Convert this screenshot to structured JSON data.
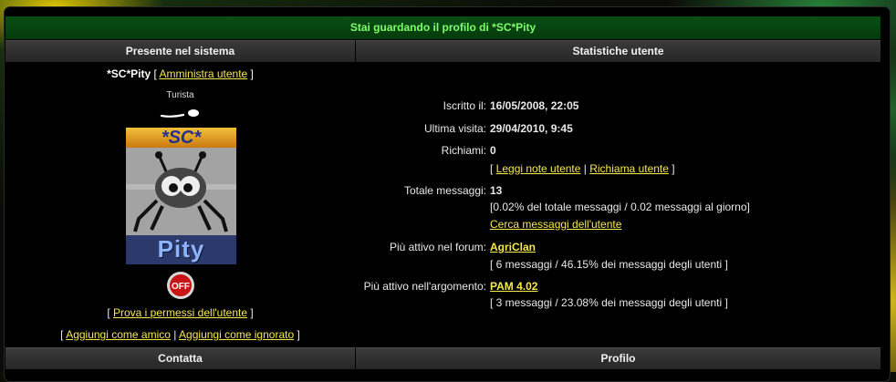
{
  "title": "Stai guardando il profilo di *SC*Pity",
  "headers": {
    "left": "Presente nel sistema",
    "right": "Statistiche utente",
    "bottom_left": "Contatta",
    "bottom_right": "Profilo"
  },
  "user": {
    "name": "*SC*Pity",
    "admin_link": "Amministra utente",
    "rank": "Turista",
    "avatar_top_text": "*SC*",
    "avatar_bottom_text": "Pity",
    "offline_badge": "OFF",
    "permissions_link": "Prova i permessi dell'utente",
    "add_friend_link": "Aggiungi come amico",
    "add_ignore_link": "Aggiungi come ignorato"
  },
  "stats": {
    "joined_label": "Iscritto il:",
    "joined_value": "16/05/2008, 22:05",
    "last_visit_label": "Ultima visita:",
    "last_visit_value": "29/04/2010, 9:45",
    "warnings_label": "Richiami:",
    "warnings_value": "0",
    "notes_link": "Leggi note utente",
    "warn_link": "Richiama utente",
    "posts_label": "Totale messaggi:",
    "posts_value": "13",
    "posts_detail": "[0.02% del totale messaggi / 0.02 messaggi al giorno]",
    "search_posts_link": "Cerca messaggi dell'utente",
    "active_forum_label": "Più attivo nel forum:",
    "active_forum_value": "AgriClan",
    "active_forum_detail": "[ 6 messaggi / 46.15% dei messaggi degli utenti ]",
    "active_topic_label": "Più attivo nell'argomento:",
    "active_topic_value": "PAM 4.02",
    "active_topic_detail": "[ 3 messaggi / 23.08% dei messaggi degli utenti ]"
  },
  "colors": {
    "title_green": "#7dff6a",
    "link_yellow": "#f6e84a",
    "header_grey": "#2f2f2f"
  }
}
